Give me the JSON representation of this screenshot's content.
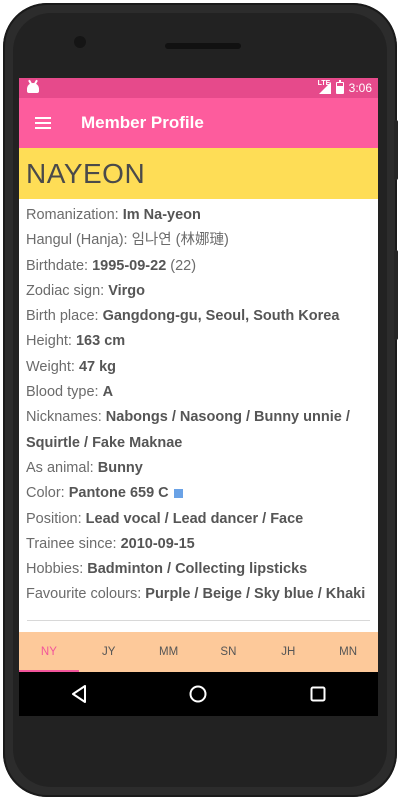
{
  "status_bar": {
    "time": "3:06",
    "network": "LTE"
  },
  "app_bar": {
    "title": "Member Profile",
    "menu_icon": "hamburger-menu-icon"
  },
  "profile": {
    "name": "NAYEON",
    "fields": [
      {
        "label": "Romanization: ",
        "value": "Im Na-yeon",
        "extra": ""
      },
      {
        "label": "Hangul (Hanja): ",
        "value": "",
        "extra": "임나연 (林娜璉)"
      },
      {
        "label": "Birthdate: ",
        "value": "1995-09-22",
        "extra": " (22)"
      },
      {
        "label": "Zodiac sign: ",
        "value": "Virgo",
        "extra": ""
      },
      {
        "label": "Birth place: ",
        "value": "Gangdong-gu, Seoul, South Korea",
        "extra": ""
      },
      {
        "label": "Height: ",
        "value": "163 cm",
        "extra": ""
      },
      {
        "label": "Weight: ",
        "value": "47 kg",
        "extra": ""
      },
      {
        "label": "Blood type: ",
        "value": "A",
        "extra": ""
      },
      {
        "label": "Nicknames: ",
        "value": "Nabongs / Nasoong / Bunny unnie / Squirtle / Fake Maknae",
        "extra": ""
      },
      {
        "label": "As animal: ",
        "value": "Bunny",
        "extra": ""
      },
      {
        "label": "Color: ",
        "value": "Pantone 659 C",
        "extra": ""
      },
      {
        "label": "Position: ",
        "value": "Lead vocal / Lead dancer / Face",
        "extra": ""
      },
      {
        "label": "Trainee since: ",
        "value": "2010-09-15",
        "extra": ""
      },
      {
        "label": "Hobbies: ",
        "value": "Badminton / Collecting lipsticks",
        "extra": ""
      },
      {
        "label": "Favourite colours: ",
        "value": "Purple / Beige / Sky blue / Khaki",
        "extra": ""
      }
    ],
    "color_swatch": "#6aa2e6"
  },
  "tabs": [
    {
      "label": "NY",
      "active": true
    },
    {
      "label": "JY",
      "active": false
    },
    {
      "label": "MM",
      "active": false
    },
    {
      "label": "SN",
      "active": false
    },
    {
      "label": "JH",
      "active": false
    },
    {
      "label": "MN",
      "active": false
    }
  ],
  "nav_bar": {
    "back_icon": "back-triangle-icon",
    "home_icon": "home-circle-icon",
    "recents_icon": "recents-square-icon"
  },
  "colors": {
    "status_bar": "#e64a8b",
    "app_bar": "#fd5c9d",
    "name_bar": "#fedd56",
    "tabs_bg": "#fdc99a",
    "active_tab": "#f2559b"
  }
}
